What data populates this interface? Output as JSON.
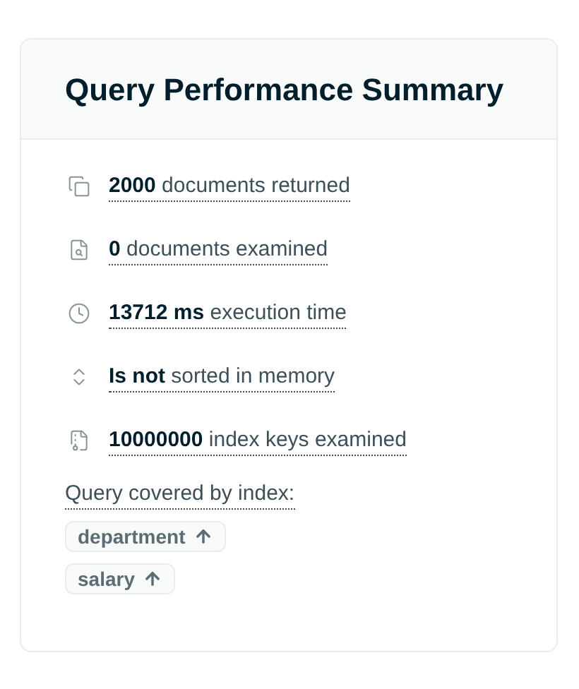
{
  "card": {
    "title": "Query Performance Summary"
  },
  "metrics": [
    {
      "kind": "documents",
      "text": "**2000** documents returned"
    },
    {
      "kind": "examined",
      "text": "**0** documents examined"
    },
    {
      "kind": "time",
      "text": "**13712 ms** execution time"
    },
    {
      "kind": "sort",
      "text": "**Is not** sorted in memory"
    },
    {
      "kind": "index",
      "text": "**10000000** index keys examined"
    }
  ],
  "index": {
    "label": "Query covered by index:",
    "keys": [
      {
        "name": "department",
        "ascending": true
      },
      {
        "name": "salary",
        "ascending": true
      }
    ]
  }
}
